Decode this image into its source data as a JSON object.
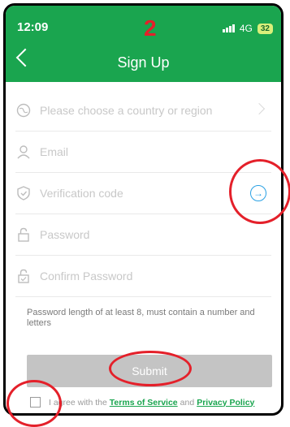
{
  "status_bar": {
    "time": "12:09",
    "network": "4G",
    "battery": "32"
  },
  "annotation_number": "2",
  "header": {
    "title": "Sign Up"
  },
  "fields": [
    {
      "name": "country",
      "placeholder": "Please choose a country or region",
      "icon": "globe-icon"
    },
    {
      "name": "email",
      "placeholder": "Email",
      "icon": "user-icon"
    },
    {
      "name": "verification",
      "placeholder": "Verification code",
      "icon": "shield-icon"
    },
    {
      "name": "password",
      "placeholder": "Password",
      "icon": "lock-icon"
    },
    {
      "name": "confirm",
      "placeholder": "Confirm Password",
      "icon": "lock-check-icon"
    }
  ],
  "hint": "Password length of at least 8, must contain a number and letters",
  "submit_label": "Submit",
  "agree": {
    "prefix": "I agree with the",
    "terms": "Terms of Service",
    "and": "and",
    "privacy": "Privacy Policy"
  },
  "colors": {
    "primary": "#1aa54f",
    "accent_blue": "#2aa1e4",
    "annotation_red": "#e4202a"
  }
}
